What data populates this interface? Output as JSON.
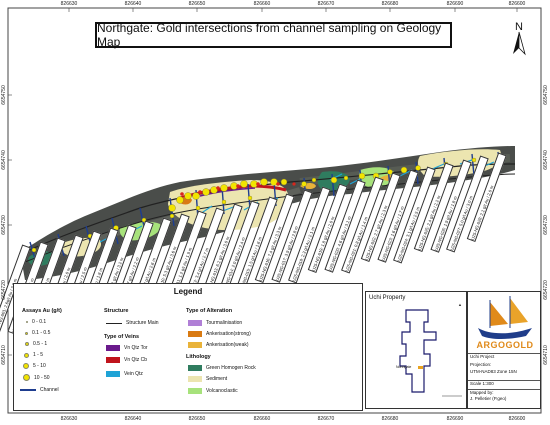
{
  "title": "Northgate: Gold intersections from channel sampling on Geology Map",
  "coordinates": {
    "easting": [
      "826630",
      "826640",
      "826650",
      "826660",
      "826670",
      "826680",
      "826690",
      "826600"
    ],
    "northing": [
      "6654750",
      "6654740",
      "6654730",
      "6654720",
      "6654710"
    ]
  },
  "north_arrow": "N",
  "channel_labels": [
    "U25-NG-001: 2.6g/t Au / 2.9 m",
    "U25-NG-002: 1.1 g/t Au / 1.5 m",
    "U25-NG-003: 3.0 g/t Au / 3.0 m",
    "U25-NG-004: 1.4 g/t Au / 2.0 m",
    "U25-NG-005: 2.2 g/t Au / 2.5 m",
    "U25-NG-006: 0.9 g/t Au / 1.8 m",
    "U25-NG-007: 4.1 g/t Au / 3.2 m",
    "U25-NG-008: 1.7 g/t Au / 2.2 m",
    "U25-NG-009: 2.8 g/t Au / 2.6 m",
    "U25-NG-010: 5.3 g/t Au / 3.6 m",
    "U25-NG-011: 1.2 g/t Au / 1.9 m",
    "U25-NG-012: 3.4 g/t Au / 2.7 m",
    "U25-NG-013: 6.2 g/t Au / 3.0 m",
    "U25-NG-014: 2.0 g/t Au / 2.4 m",
    "U25-NG-015: 1.5 g/t Au / 1.6 m",
    "U25-NG-016: 7.4 g/t Au / 3.3 m",
    "U25-NG-017: 3.9 g/t Au / 2.8 m",
    "U25-NG-018: 2.3 g/t Au / 2.1 m",
    "U25-NG-019: 1.8 g/t Au / 2.0 m",
    "U25-NG-020: 4.6 g/t Au / 3.1 m",
    "U25-NG-021: 0.8 g/t Au / 1.4 m",
    "U25-NG-022: 2.7 g/t Au / 2.3 m",
    "U25-NG-023: 1.6 g/t Au / 1.7 m",
    "U25-NG-024: 3.1 g/t Au / 2.5 m",
    "U25-NG-025: 2.4 g/t Au / 2.2 m",
    "U25-NG-026: 1.9 g/t Au / 1.8 m",
    "U25-NG-027: 5.0 g/t Au / 3.0 m",
    "U25-NG-028: 2.1 g/t Au / 2.0 m"
  ],
  "legend": {
    "title": "Legend",
    "assays": {
      "title": "Assays Au (g/t)",
      "items": [
        "0 - 0.1",
        "0.1 - 0.5",
        "0.5 - 1",
        "1 - 5",
        "5 - 10",
        "10 - 50"
      ],
      "channel": "Channel"
    },
    "structure": {
      "title": "Structure",
      "item": "Structure Main"
    },
    "veins": {
      "title": "Type of Veins",
      "items": [
        "Vn Qtz Tor",
        "Vn Qtz Cb",
        "Vein Qtz"
      ]
    },
    "alteration": {
      "title": "Type of Alteration",
      "items": [
        "Tourmalinisation",
        "Ankerisation(strong)",
        "Ankerisation(weak)"
      ]
    },
    "lithology": {
      "title": "Lithology",
      "items": [
        "Green Homogen Rock",
        "Sediment",
        "Volcanoclastic"
      ]
    }
  },
  "colors": {
    "vein_tor": "#6a1a8c",
    "vein_cb": "#c0141c",
    "vein_qtz": "#1fa3d6",
    "tourmalinisation": "#b07fd6",
    "ank_strong": "#d97a12",
    "ank_weak": "#e9b33a",
    "green_rock": "#2f7c5f",
    "sediment": "#ece5b0",
    "volcano": "#a7e27b",
    "channel": "#1e3d8f",
    "assay": "#f2e400"
  },
  "inset": {
    "title": "Uchi Property",
    "label": "Northgate"
  },
  "title_block": {
    "logo": "ARGOGOLD",
    "project": "Uchi Project",
    "projection_label": "Projection:",
    "projection": "UTM-NAD83 Zone 15N",
    "scale": "Scale 1:300",
    "mapped_label": "Mapped by:",
    "mapped_by": "J. Pelletier (P.geo)"
  }
}
